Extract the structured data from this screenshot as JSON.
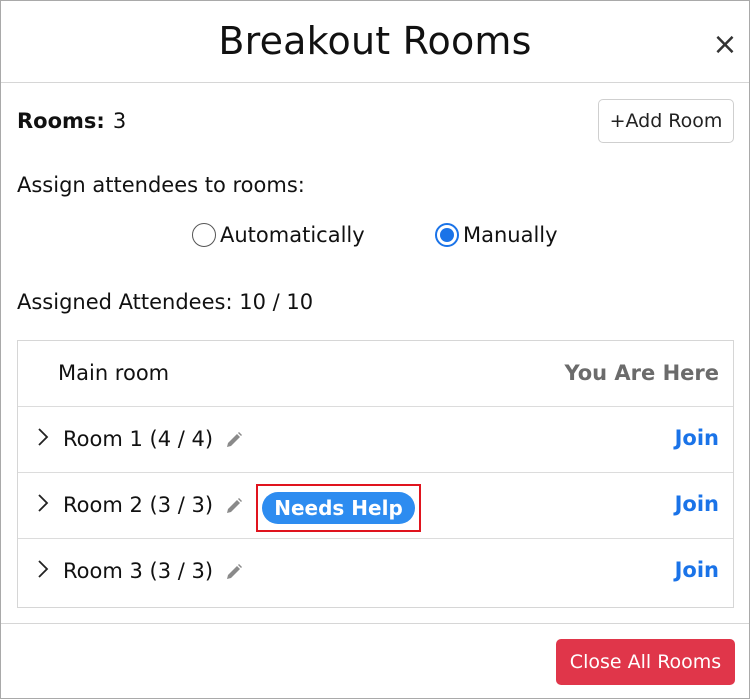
{
  "header": {
    "title": "Breakout Rooms",
    "close_glyph": "×"
  },
  "rooms": {
    "label": "Rooms:",
    "count": "3",
    "add_button": "+Add Room"
  },
  "assign": {
    "label": "Assign attendees to rooms:",
    "options": [
      {
        "label": "Automatically",
        "checked": false
      },
      {
        "label": "Manually",
        "checked": true
      }
    ]
  },
  "assigned": {
    "text": "Assigned Attendees: 10 / 10"
  },
  "table": {
    "main_room": {
      "name": "Main room",
      "status": "You Are Here"
    },
    "rooms": [
      {
        "name": "Room 1 (4 / 4)",
        "action": "Join",
        "badge": ""
      },
      {
        "name": "Room 2 (3 / 3)",
        "action": "Join",
        "badge": "Needs Help"
      },
      {
        "name": "Room 3 (3 / 3)",
        "action": "Join",
        "badge": ""
      }
    ]
  },
  "footer": {
    "close_all": "Close All Rooms"
  },
  "colors": {
    "accent": "#1a73e8",
    "badge": "#2d8cf0",
    "danger": "#e0364a",
    "highlight": "#e0141e"
  },
  "icons": {
    "close": "close-icon",
    "chevron": "chevron-right-icon",
    "edit": "pencil-icon"
  }
}
